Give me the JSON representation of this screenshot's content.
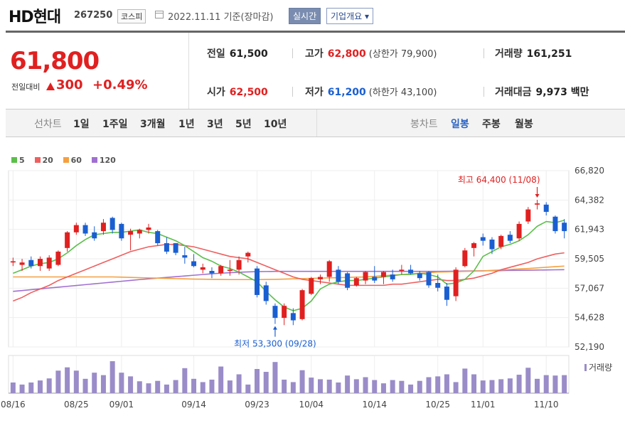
{
  "header": {
    "name": "HD현대",
    "code": "267250",
    "market": "코스피",
    "date": "2022.11.11 기준(장마감)",
    "realtime": "실시간",
    "company_info": "기업개요"
  },
  "price": {
    "current": "61,800",
    "compare_label": "전일대비",
    "change": "300",
    "change_pct": "+0.49%",
    "direction": "up"
  },
  "stats": {
    "prev_label": "전일",
    "prev": "61,500",
    "high_label": "고가",
    "high": "62,800",
    "upper_limit": "(상한가 79,900)",
    "volume_label": "거래량",
    "volume": "161,251",
    "open_label": "시가",
    "open": "62,500",
    "low_label": "저가",
    "low": "61,200",
    "lower_limit": "(하한가 43,100)",
    "value_label": "거래대금",
    "value": "9,973 백만"
  },
  "tabs": {
    "line_label": "선차트",
    "line_periods": [
      "1일",
      "1주일",
      "3개월",
      "1년",
      "3년",
      "5년",
      "10년"
    ],
    "candle_label": "봉차트",
    "candle_periods": [
      "일봉",
      "주봉",
      "월봉"
    ],
    "active_candle": "일봉"
  },
  "colors": {
    "up": "#e02020",
    "down": "#1a5fd1",
    "ma5": "#5bbf4a",
    "ma20": "#ef5f5f",
    "ma60": "#f5a040",
    "ma120": "#a070d0",
    "volume": "#9a8cc8"
  },
  "chart_data": {
    "type": "candlestick",
    "ma_legend": [
      {
        "name": "5",
        "color": "#5bbf4a"
      },
      {
        "name": "20",
        "color": "#ef5f5f"
      },
      {
        "name": "60",
        "color": "#f5a040"
      },
      {
        "name": "120",
        "color": "#a070d0"
      }
    ],
    "y_ticks": [
      "66,820",
      "64,382",
      "61,943",
      "59,505",
      "57,067",
      "54,628",
      "52,190"
    ],
    "ylim": [
      52190,
      66820
    ],
    "x_ticks": [
      {
        "label": "08/16",
        "index": 0
      },
      {
        "label": "08/25",
        "index": 7
      },
      {
        "label": "09/01",
        "index": 12
      },
      {
        "label": "09/14",
        "index": 20
      },
      {
        "label": "09/23",
        "index": 27
      },
      {
        "label": "10/04",
        "index": 33
      },
      {
        "label": "10/14",
        "index": 40
      },
      {
        "label": "10/25",
        "index": 47
      },
      {
        "label": "11/01",
        "index": 52
      },
      {
        "label": "11/10",
        "index": 59
      }
    ],
    "ohlc": [
      [
        59200,
        59600,
        58900,
        59300
      ],
      [
        59000,
        59500,
        58500,
        59200
      ],
      [
        59400,
        59700,
        58700,
        58900
      ],
      [
        58900,
        59700,
        58500,
        59500
      ],
      [
        58700,
        59800,
        58500,
        59600
      ],
      [
        59000,
        60200,
        58900,
        60100
      ],
      [
        60400,
        61800,
        60100,
        61700
      ],
      [
        61700,
        62500,
        61500,
        62300
      ],
      [
        62300,
        62500,
        61400,
        61600
      ],
      [
        61700,
        62200,
        61000,
        61200
      ],
      [
        61800,
        62800,
        61500,
        62500
      ],
      [
        62900,
        63000,
        61600,
        61900
      ],
      [
        62400,
        62500,
        61000,
        61200
      ],
      [
        61500,
        62000,
        60200,
        61800
      ],
      [
        61600,
        62000,
        61200,
        61900
      ],
      [
        61900,
        62400,
        61600,
        62100
      ],
      [
        61800,
        61900,
        60600,
        60800
      ],
      [
        60800,
        61300,
        59900,
        60100
      ],
      [
        60800,
        60800,
        59800,
        60000
      ],
      [
        59800,
        60500,
        59100,
        59600
      ],
      [
        59300,
        59900,
        58800,
        58900
      ],
      [
        58600,
        59100,
        58300,
        58800
      ],
      [
        58500,
        58800,
        57900,
        58300
      ],
      [
        58300,
        59000,
        58100,
        58900
      ],
      [
        58500,
        59400,
        58100,
        58600
      ],
      [
        58600,
        59700,
        58200,
        59400
      ],
      [
        59700,
        60100,
        59200,
        60000
      ],
      [
        58700,
        58900,
        56300,
        56500
      ],
      [
        57300,
        57600,
        55700,
        56000
      ],
      [
        55600,
        55800,
        54100,
        54600
      ],
      [
        54600,
        55800,
        54000,
        55600
      ],
      [
        55000,
        55400,
        54000,
        54400
      ],
      [
        54500,
        57000,
        54400,
        56900
      ],
      [
        56600,
        58000,
        56500,
        57900
      ],
      [
        57800,
        58200,
        57400,
        58000
      ],
      [
        58000,
        59400,
        57600,
        59300
      ],
      [
        58600,
        58900,
        57400,
        57600
      ],
      [
        58300,
        58400,
        56900,
        57100
      ],
      [
        57300,
        58000,
        57200,
        57900
      ],
      [
        57700,
        58500,
        57400,
        58400
      ],
      [
        58000,
        58900,
        57500,
        57700
      ],
      [
        58000,
        58500,
        57400,
        58400
      ],
      [
        58200,
        58600,
        57600,
        57800
      ],
      [
        58500,
        59000,
        58200,
        58600
      ],
      [
        58600,
        59000,
        58200,
        58300
      ],
      [
        58300,
        58500,
        57700,
        57900
      ],
      [
        58400,
        58500,
        57100,
        57300
      ],
      [
        57500,
        58200,
        56800,
        57100
      ],
      [
        57200,
        57500,
        55600,
        56100
      ],
      [
        56400,
        58800,
        56000,
        58600
      ],
      [
        58900,
        60400,
        58800,
        60200
      ],
      [
        60400,
        60900,
        59700,
        60800
      ],
      [
        61300,
        61600,
        60600,
        61000
      ],
      [
        61100,
        61300,
        59900,
        60300
      ],
      [
        60500,
        61500,
        60300,
        61400
      ],
      [
        61500,
        61800,
        60800,
        61000
      ],
      [
        61200,
        62600,
        61000,
        62400
      ],
      [
        62600,
        63800,
        62400,
        63600
      ],
      [
        64000,
        64400,
        63600,
        64100
      ],
      [
        64000,
        64200,
        63100,
        63400
      ],
      [
        63000,
        63100,
        61600,
        61800
      ],
      [
        62500,
        62800,
        61200,
        61800
      ]
    ],
    "ma5": [
      58300,
      58600,
      58900,
      59100,
      59200,
      59500,
      60000,
      60600,
      61100,
      61500,
      61600,
      61700,
      61700,
      61800,
      61900,
      61700,
      61600,
      61300,
      61000,
      60600,
      60100,
      59600,
      59300,
      58900,
      58700,
      58400,
      58000,
      57600,
      56800,
      56100,
      55500,
      55200,
      55400,
      56000,
      57000,
      57400,
      57600,
      57700,
      57700,
      57800,
      57900,
      58000,
      58100,
      58200,
      58200,
      58300,
      58200,
      58000,
      57400,
      57500,
      57800,
      58500,
      59700,
      60100,
      60500,
      60700,
      61000,
      61500,
      62200,
      62600,
      62500,
      62700
    ],
    "ma20": [
      56000,
      56300,
      56700,
      57000,
      57300,
      57700,
      58000,
      58300,
      58600,
      58900,
      59200,
      59500,
      59800,
      60100,
      60300,
      60500,
      60600,
      60700,
      60700,
      60600,
      60500,
      60300,
      60100,
      59900,
      59700,
      59600,
      59500,
      59200,
      58900,
      58600,
      58300,
      58000,
      57800,
      57700,
      57600,
      57500,
      57400,
      57300,
      57300,
      57300,
      57300,
      57300,
      57400,
      57400,
      57500,
      57600,
      57700,
      57800,
      57700,
      57700,
      57800,
      57900,
      58100,
      58300,
      58600,
      58800,
      59000,
      59200,
      59500,
      59700,
      59900,
      60000
    ],
    "ma60": [
      58000,
      58000,
      58000,
      58000,
      58000,
      58000,
      58000,
      58000,
      58000,
      58000,
      58000,
      58000,
      57980,
      57960,
      57940,
      57920,
      57900,
      57880,
      57860,
      57840,
      57820,
      57810,
      57800,
      57790,
      57780,
      57780,
      57780,
      57780,
      57790,
      57800,
      57820,
      57840,
      57860,
      57880,
      57900,
      57920,
      57940,
      57960,
      57980,
      58000,
      58050,
      58100,
      58150,
      58200,
      58250,
      58300,
      58350,
      58400,
      58420,
      58440,
      58460,
      58480,
      58500,
      58540,
      58580,
      58620,
      58660,
      58700,
      58750,
      58800,
      58850,
      58900
    ],
    "ma120": [
      56800,
      56870,
      56940,
      57010,
      57080,
      57150,
      57220,
      57290,
      57360,
      57430,
      57500,
      57570,
      57640,
      57710,
      57780,
      57840,
      57900,
      57960,
      58020,
      58080,
      58140,
      58200,
      58260,
      58310,
      58350,
      58390,
      58420,
      58440,
      58450,
      58460,
      58460,
      58460,
      58460,
      58460,
      58460,
      58460,
      58460,
      58460,
      58460,
      58460,
      58460,
      58460,
      58460,
      58460,
      58460,
      58460,
      58460,
      58460,
      58470,
      58480,
      58490,
      58500,
      58510,
      58520,
      58530,
      58540,
      58550,
      58560,
      58570,
      58580,
      58590,
      58600
    ],
    "volume_label": "거래량",
    "volume": [
      2.6,
      2.1,
      2.6,
      3.1,
      3.6,
      5.5,
      6.3,
      5.5,
      3.5,
      5.0,
      4.4,
      7.8,
      5.0,
      4.1,
      2.9,
      2.4,
      3.0,
      2.1,
      3.2,
      6.1,
      3.5,
      2.7,
      3.3,
      6.5,
      3.1,
      4.6,
      2.1,
      5.9,
      5.2,
      7.6,
      3.3,
      2.7,
      5.6,
      3.8,
      3.4,
      3.3,
      2.6,
      4.3,
      3.4,
      3.9,
      3.2,
      2.4,
      3.2,
      3.0,
      2.1,
      3.0,
      3.9,
      4.1,
      4.6,
      2.7,
      6.0,
      4.6,
      3.1,
      3.2,
      3.4,
      3.6,
      4.5,
      6.2,
      3.5,
      4.4,
      4.3,
      4.4
    ],
    "high_annotation": "최고 64,400 (11/08)",
    "high_index": 58,
    "low_annotation": "최저 53,300 (09/28)",
    "low_index": 29
  }
}
